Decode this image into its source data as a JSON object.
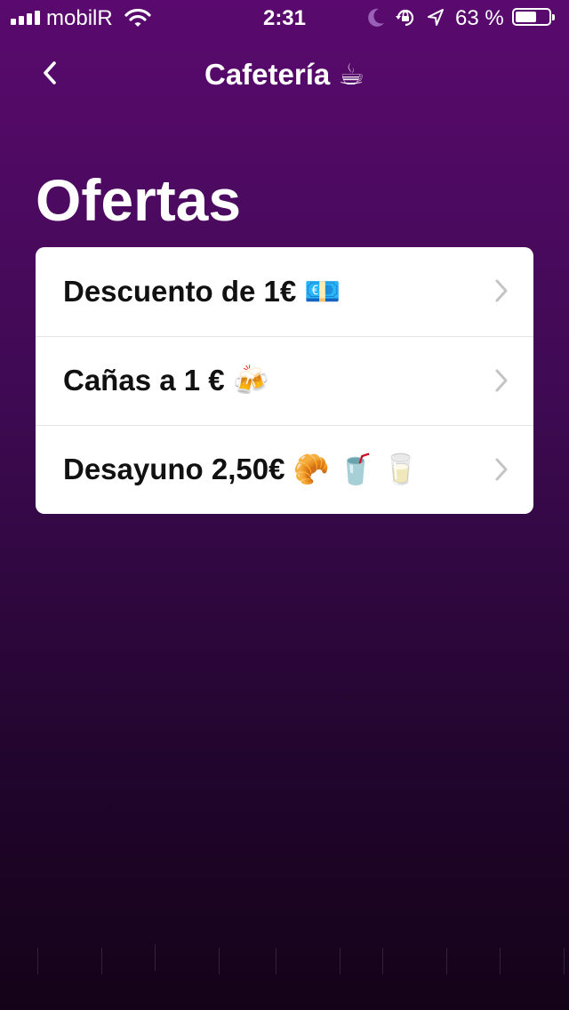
{
  "status_bar": {
    "carrier": "mobilR",
    "time": "2:31",
    "battery_percent_label": "63 %",
    "battery_level": 0.63,
    "signal_bars": 4,
    "icons": [
      "signal-icon",
      "wifi-icon",
      "moon-icon",
      "rotation-lock-icon",
      "location-icon",
      "battery-icon"
    ]
  },
  "nav": {
    "back_icon": "chevron-left-icon",
    "title": "Cafetería ☕"
  },
  "page": {
    "title": "Ofertas"
  },
  "offers": [
    {
      "label": "Descuento de 1€ 💶"
    },
    {
      "label": "Cañas a 1 € 🍻"
    },
    {
      "label": "Desayuno 2,50€ 🥐 🥤 🥛"
    }
  ],
  "colors": {
    "background_top": "#5a0a6e",
    "background_bottom": "#140318",
    "card": "#ffffff",
    "row_text": "#111111",
    "chevron": "#c4c4c7"
  }
}
